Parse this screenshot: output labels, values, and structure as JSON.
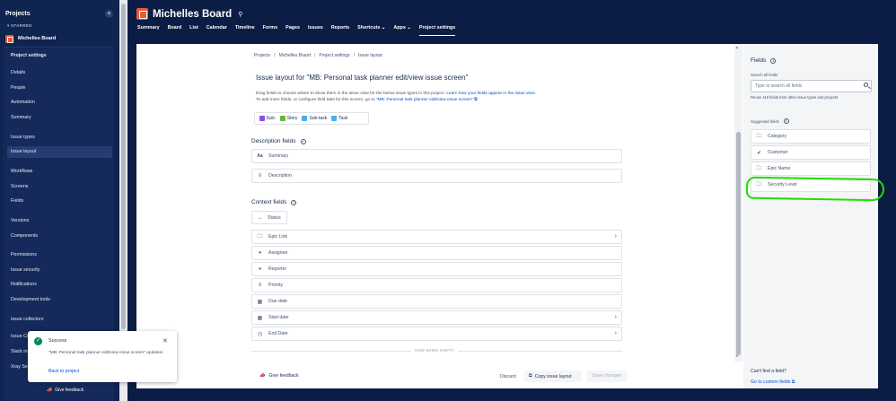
{
  "sidebar": {
    "heading": "Projects",
    "plus": "+",
    "starred_label": "STARRED",
    "project_name": "Michelles Board",
    "nav": [
      {
        "label": "Project settings",
        "top": 0
      },
      {
        "label": "Details"
      },
      {
        "label": "People"
      },
      {
        "label": "Automation"
      },
      {
        "label": "Summary"
      },
      {
        "label": "Issue types"
      },
      {
        "label": "Issue layout"
      },
      {
        "label": "Workflows"
      },
      {
        "label": "Screens"
      },
      {
        "label": "Fields"
      },
      {
        "label": "Versions"
      },
      {
        "label": "Components"
      },
      {
        "label": "Permissions"
      },
      {
        "label": "Issue security"
      },
      {
        "label": "Notifications"
      },
      {
        "label": "Development tools"
      },
      {
        "label": "Issue collectors"
      },
      {
        "label": "Issue Cr"
      },
      {
        "label": "Slack in"
      },
      {
        "label": "Xray Set"
      }
    ],
    "give_feedback": "Give feedback"
  },
  "header": {
    "title": "Michelles Board",
    "tabs": [
      "Summary",
      "Board",
      "List",
      "Calendar",
      "Timeline",
      "Forms",
      "Pages",
      "Issues",
      "Reports",
      "Shortcuts ⌄",
      "Apps ⌄",
      "Project settings"
    ],
    "active_tab": "Project settings"
  },
  "main": {
    "breadcrumb": [
      "Projects",
      "Michelles Board",
      "Project settings",
      "Issue layout"
    ],
    "title": "Issue layout for \"MB: Personal task planner edit/view issue screen\"",
    "desc_line1": "Drag fields to choose where to show them in the issue view for the below issue types in this project. ",
    "desc_link1": "Learn how your fields appear in the issue view.",
    "desc_line2": "To add more fields, or configure field tabs for this screen, go to ",
    "desc_link2": "\"MB: Personal task planner edit/view issue screen\"",
    "issue_types": [
      {
        "label": "Epic",
        "color": "#904ee2"
      },
      {
        "label": "Story",
        "color": "#63ba3c"
      },
      {
        "label": "Sub-task",
        "color": "#4bade8"
      },
      {
        "label": "Task",
        "color": "#4bade8"
      }
    ],
    "description_fields_heading": "Description fields",
    "description_fields": [
      {
        "label": "Summary",
        "icon": "Aa"
      },
      {
        "label": "Description",
        "icon": "≡"
      }
    ],
    "context_fields_heading": "Context fields",
    "status_label": "Status",
    "context_fields": [
      {
        "label": "Epic Link",
        "icon": "folder-icon",
        "chevron": true
      },
      {
        "label": "Assignee",
        "icon": "user-icon",
        "chevron": false
      },
      {
        "label": "Reporter",
        "icon": "user-icon",
        "chevron": false
      },
      {
        "label": "Priority",
        "icon": "priority-icon",
        "chevron": false
      },
      {
        "label": "Due date",
        "icon": "calendar-icon",
        "chevron": false
      },
      {
        "label": "Start date",
        "icon": "calendar-icon",
        "chevron": true
      },
      {
        "label": "End Date",
        "icon": "clock-icon",
        "chevron": true
      }
    ],
    "hide_when_empty": "HIDE WHEN EMPTY",
    "give_feedback": "Give feedback",
    "discard": "Discard",
    "copy_layout": "Copy issue layout",
    "save_changes": "Save changes"
  },
  "right_panel": {
    "heading": "Fields",
    "search_label": "Search all fields",
    "search_placeholder": "Type to search all fields",
    "reuse_text": "Reuse 119 fields from other issue types and projects",
    "suggested_heading": "Suggested fields",
    "suggested": [
      {
        "label": "Category",
        "icon": "folder-icon"
      },
      {
        "label": "Customer",
        "icon": "check-circle-icon"
      },
      {
        "label": "Epic Name",
        "icon": "folder-icon"
      },
      {
        "label": "Security Level",
        "icon": "folder-icon"
      }
    ],
    "cant_find": "Can't find a field?",
    "custom_link": "Go to custom fields"
  },
  "toast": {
    "title": "Success",
    "message": "\"MB: Personal task planner edit/view issue screen\" updated.",
    "back_link": "Back to project"
  },
  "colors": {
    "nav_bg": "#0b1d44",
    "highlight": "#22dd00",
    "link": "#0052cc",
    "success": "#00875a"
  }
}
